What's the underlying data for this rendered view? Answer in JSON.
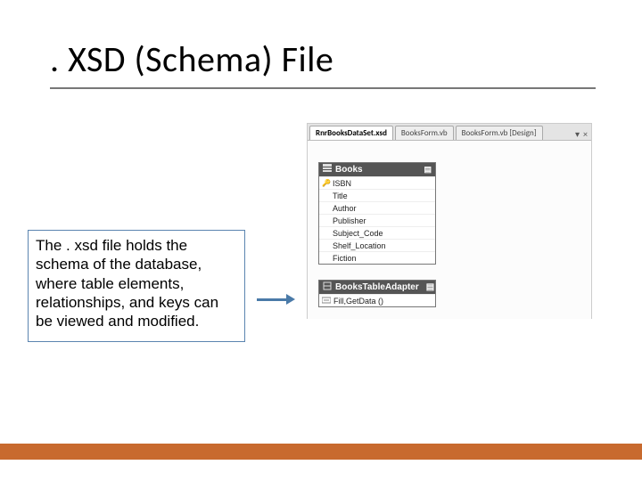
{
  "title": ". XSD (Schema) File",
  "textbox": "The . xsd file holds the schema of the database, where table elements, relationships, and keys can be viewed and modified.",
  "shot": {
    "tabs": [
      "RnrBooksDataSet.xsd",
      "BooksForm.vb",
      "BooksForm.vb [Design]"
    ],
    "table": {
      "name": "Books",
      "fields": [
        {
          "key": true,
          "name": "ISBN"
        },
        {
          "key": false,
          "name": "Title"
        },
        {
          "key": false,
          "name": "Author"
        },
        {
          "key": false,
          "name": "Publisher"
        },
        {
          "key": false,
          "name": "Subject_Code"
        },
        {
          "key": false,
          "name": "Shelf_Location"
        },
        {
          "key": false,
          "name": "Fiction"
        }
      ]
    },
    "adapter": {
      "name": "BooksTableAdapter",
      "method": "Fill,GetData ()"
    }
  }
}
